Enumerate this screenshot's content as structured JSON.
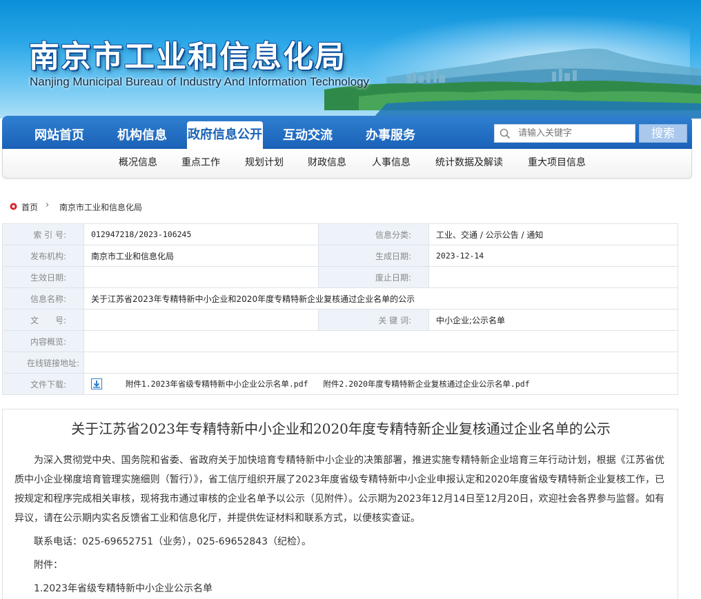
{
  "header": {
    "title_cn": "南京市工业和信息化局",
    "title_en": "Nanjing Municipal Bureau of Industry And Information Technology"
  },
  "nav": {
    "items": [
      {
        "label": "网站首页",
        "active": false
      },
      {
        "label": "机构信息",
        "active": false
      },
      {
        "label": "政府信息公开",
        "active": true
      },
      {
        "label": "互动交流",
        "active": false
      },
      {
        "label": "办事服务",
        "active": false
      }
    ],
    "search_placeholder": "请输入关键字",
    "search_button": "搜索"
  },
  "subnav": {
    "items": [
      "概况信息",
      "重点工作",
      "规划计划",
      "财政信息",
      "人事信息",
      "统计数据及解读",
      "重大项目信息"
    ]
  },
  "breadcrumb": {
    "home": "首页",
    "current": "南京市工业和信息化局"
  },
  "meta": {
    "index_label": "索 引 号:",
    "index_value": "012947218/2023-106245",
    "category_label": "信息分类:",
    "category_value": "工业、交通 / 公示公告 / 通知",
    "publisher_label": "发布机构:",
    "publisher_value": "南京市工业和信息化局",
    "created_label": "生成日期:",
    "created_value": "2023-12-14",
    "effective_label": "生效日期:",
    "effective_value": "",
    "expire_label": "废止日期:",
    "expire_value": "",
    "name_label": "信息名称:",
    "name_value": "关于江苏省2023年专精特新中小企业和2020年度专精特新企业复核通过企业名单的公示",
    "docno_label": "文　　号:",
    "docno_value": "",
    "keywords_label": "关 键 词:",
    "keywords_value": "中小企业;公示名单",
    "summary_label": "内容概览:",
    "summary_value": "",
    "link_label": "在线链接地址:",
    "link_value": "",
    "download_label": "文件下载:",
    "attachments": [
      "附件1.2023年省级专精特新中小企业公示名单.pdf",
      "附件2.2020年度专精特新企业复核通过企业公示名单.pdf"
    ]
  },
  "article": {
    "title": "关于江苏省2023年专精特新中小企业和2020年度专精特新企业复核通过企业名单的公示",
    "paragraph": "为深入贯彻党中央、国务院和省委、省政府关于加快培育专精特新中小企业的决策部署，推进实施专精特新企业培育三年行动计划，根据《江苏省优质中小企业梯度培育管理实施细则（暂行）》，省工信厅组织开展了2023年度省级专精特新中小企业申报认定和2020年度省级专精特新企业复核工作，已按规定和程序完成相关审核，现将我市通过审核的企业名单予以公示（见附件）。公示期为2023年12月14日至12月20日，欢迎社会各界参与监督。如有异议，请在公示期内实名反馈省工业和信息化厅，并提供佐证材料和联系方式，以便核实查证。",
    "contact": "联系电话：025-69652751（业务），025-69652843（纪检）。",
    "attachment_heading": "附件：",
    "attachment_item1": "1.2023年省级专精特新中小企业公示名单"
  },
  "colors": {
    "nav_blue": "#1a62b8",
    "label_bg": "#eef3f9",
    "breadcrumb_icon": "#d9232d"
  }
}
